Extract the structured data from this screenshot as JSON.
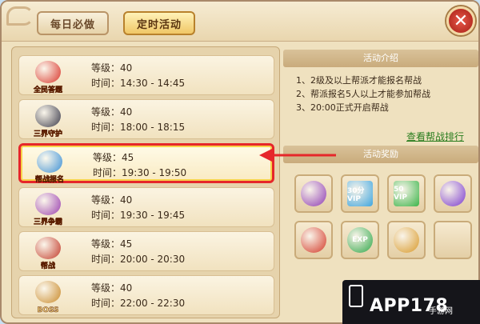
{
  "tabs": [
    {
      "label": "每日必做",
      "active": false
    },
    {
      "label": "定时活动",
      "active": true
    }
  ],
  "close_label": "✕",
  "activities": [
    {
      "caption": "全民答题",
      "level_label": "等级：40",
      "time_label": "时间：14:30 - 14:45",
      "icon": "gold-sack-icon",
      "color": "#d9352b",
      "highlight": false
    },
    {
      "caption": "三界守护",
      "level_label": "等级：40",
      "time_label": "时间：18:00 - 18:15",
      "icon": "dark-warrior-icon",
      "color": "#3a3a4a",
      "highlight": false
    },
    {
      "caption": "帮战报名",
      "level_label": "等级：45",
      "time_label": "时间：19:30 - 19:50",
      "icon": "horn-icon",
      "color": "#3a8fd6",
      "highlight": true
    },
    {
      "caption": "三界争霸",
      "level_label": "等级：40",
      "time_label": "时间：19:30 - 19:45",
      "icon": "purple-orb-icon",
      "color": "#9a3fb0",
      "highlight": false
    },
    {
      "caption": "帮战",
      "level_label": "等级：45",
      "time_label": "时间：20:00 - 20:30",
      "icon": "crossed-swords-icon",
      "color": "#c23a2a",
      "highlight": false
    },
    {
      "caption": "BOSS",
      "level_label": "等级：40",
      "time_label": "时间：22:00 - 22:30",
      "icon": "boss-helmet-icon",
      "color": "#c98a2a",
      "highlight": false
    }
  ],
  "intro": {
    "title": "活动介绍",
    "lines": [
      "1、2级及以上帮派才能报名帮战",
      "2、帮派报名5人以上才能参加帮战",
      "3、20:00正式开启帮战"
    ],
    "rank_link": "查看帮战排行"
  },
  "rewards": {
    "title": "活动奖励",
    "items": [
      {
        "icon": "gem-amulet-icon",
        "label": "",
        "color": "#8e3bb5"
      },
      {
        "icon": "vip-card-30-icon",
        "label": "30分 VIP",
        "color": "#3fa6e0"
      },
      {
        "icon": "vip-card-50-icon",
        "label": "50 VIP",
        "color": "#3bb54a"
      },
      {
        "icon": "purple-crystal-icon",
        "label": "",
        "color": "#7a3ad0"
      },
      {
        "icon": "guild-banner-icon",
        "label": "",
        "color": "#d43a2a"
      },
      {
        "icon": "exp-orb-icon",
        "label": "EXP",
        "color": "#2fa84a"
      },
      {
        "icon": "gold-coin-icon",
        "label": "",
        "color": "#d99a2a"
      },
      {
        "icon": "empty-slot",
        "label": "",
        "color": ""
      }
    ]
  },
  "watermark": {
    "brand": "APP178",
    "sub": "手游网"
  }
}
